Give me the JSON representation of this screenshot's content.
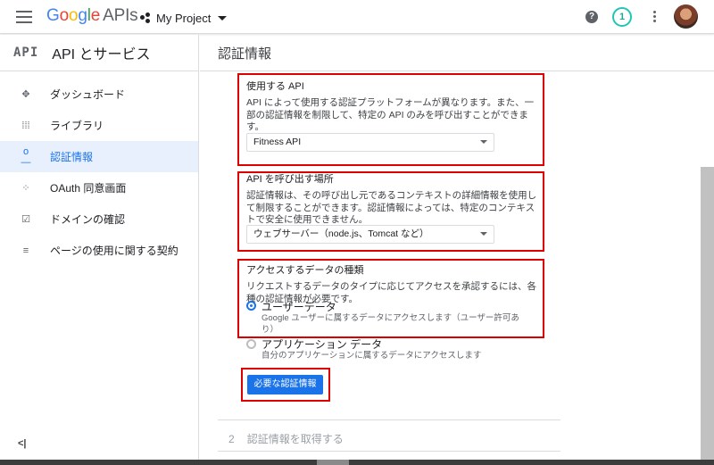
{
  "topbar": {
    "logo_google": [
      "G",
      "o",
      "o",
      "g",
      "l",
      "e"
    ],
    "logo_apis": "APIs",
    "project_name": "My Project",
    "help_symbol": "?",
    "notification_count": "1"
  },
  "sidebar": {
    "api_logo": "API",
    "title": "API とサービス",
    "items": [
      {
        "label": "ダッシュボード",
        "icon": "dashboard-icon",
        "glyph": "✥"
      },
      {
        "label": "ライブラリ",
        "icon": "library-icon",
        "glyph": "⁞⁞⁞"
      },
      {
        "label": "認証情報",
        "icon": "key-icon",
        "glyph": "o—",
        "active": true
      },
      {
        "label": "OAuth 同意画面",
        "icon": "consent-icon",
        "glyph": "⁘"
      },
      {
        "label": "ドメインの確認",
        "icon": "verify-icon",
        "glyph": "☑"
      },
      {
        "label": "ページの使用に関する契約",
        "icon": "agreement-icon",
        "glyph": "≡"
      }
    ],
    "collapse_symbol": "<|"
  },
  "main": {
    "page_title": "認証情報",
    "api_section": {
      "title": "使用する API",
      "description": "API によって使用する認証プラットフォームが異なります。また、一部の認証情報を制限して、特定の API のみを呼び出すことができます。",
      "selected": "Fitness API"
    },
    "caller_section": {
      "title": "API を呼び出す場所",
      "description": "認証情報は、その呼び出し元であるコンテキストの詳細情報を使用して制限することができます。認証情報によっては、特定のコンテキストで安全に使用できません。",
      "selected": "ウェブサーバー（node.js、Tomcat など）"
    },
    "data_section": {
      "title": "アクセスするデータの種類",
      "description": "リクエストするデータのタイプに応じてアクセスを承認するには、各種の認証情報が必要です。",
      "options": [
        {
          "label": "ユーザーデータ",
          "help": "Google ユーザーに属するデータにアクセスします（ユーザー許可あり）",
          "checked": true
        },
        {
          "label": "アプリケーション データ",
          "help": "自分のアプリケーションに属するデータにアクセスします",
          "checked": false
        }
      ]
    },
    "submit_label": "必要な認証情報",
    "step2": {
      "number": "2",
      "label": "認証情報を取得する"
    }
  },
  "colors": {
    "accent": "#1a73e8",
    "highlight_box": "#dd0000",
    "active_nav_bg": "#e8f0fe"
  }
}
